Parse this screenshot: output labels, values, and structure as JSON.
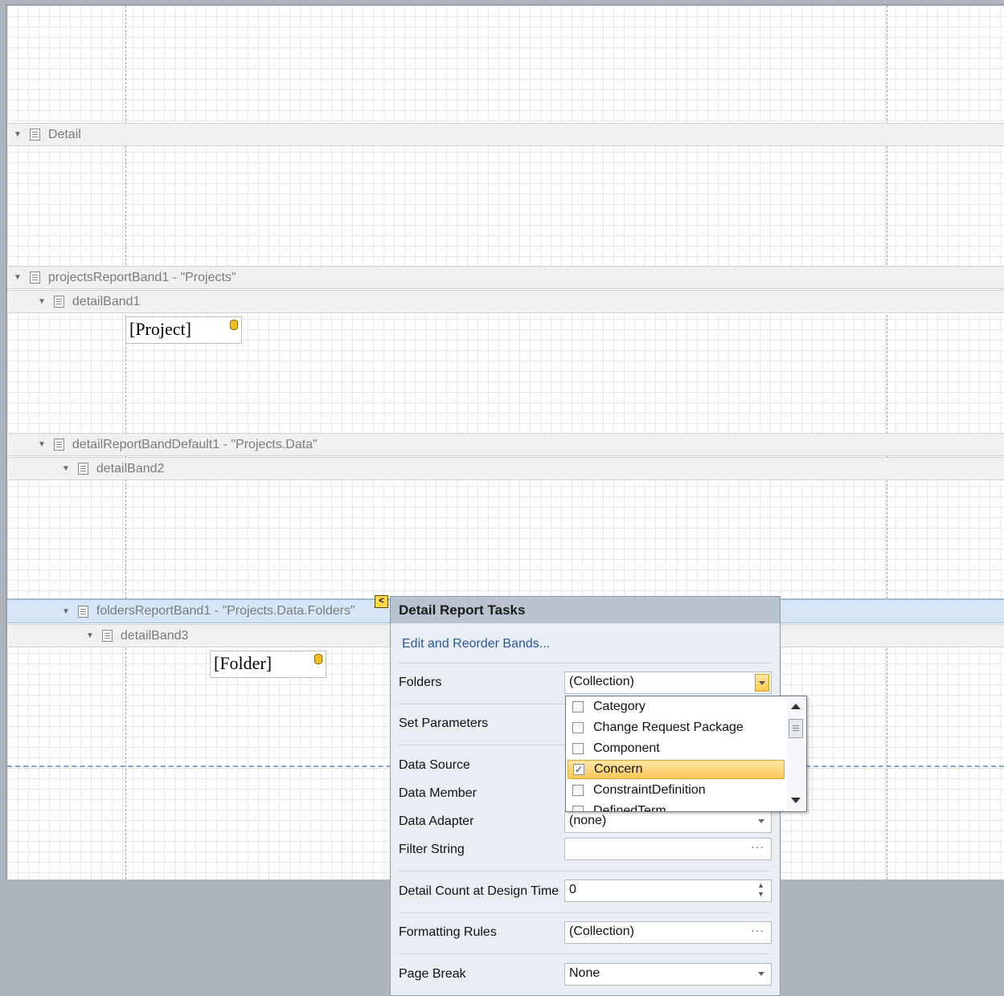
{
  "bands": [
    {
      "label": "Detail"
    },
    {
      "label": "projectsReportBand1 - \"Projects\""
    },
    {
      "label": "detailBand1"
    },
    {
      "label": "detailReportBandDefault1 - \"Projects.Data\""
    },
    {
      "label": "detailBand2"
    },
    {
      "label": "foldersReportBand1 - \"Projects.Data.Folders\""
    },
    {
      "label": "detailBand3"
    }
  ],
  "fields": {
    "project": "[Project]",
    "folder": "[Folder]"
  },
  "smart_tag": {
    "glyph": "<"
  },
  "tasks": {
    "title": "Detail Report Tasks",
    "link": "Edit and Reorder Bands...",
    "folders": {
      "label": "Folders",
      "value": "(Collection)"
    },
    "set_parameters": {
      "label": "Set Parameters"
    },
    "data_source": {
      "label": "Data Source"
    },
    "data_member": {
      "label": "Data Member"
    },
    "data_adapter": {
      "label": "Data Adapter",
      "value": "(none)"
    },
    "filter_string": {
      "label": "Filter String",
      "value": ""
    },
    "detail_count": {
      "label": "Detail Count at Design Time",
      "value": "0"
    },
    "formatting_rules": {
      "label": "Formatting Rules",
      "value": "(Collection)"
    },
    "page_break": {
      "label": "Page Break",
      "value": "None"
    }
  },
  "dropdown": {
    "items": [
      {
        "label": "Category",
        "checked": false
      },
      {
        "label": "Change Request Package",
        "checked": false
      },
      {
        "label": "Component",
        "checked": false
      },
      {
        "label": "Concern",
        "checked": true
      },
      {
        "label": "ConstraintDefinition",
        "checked": false
      },
      {
        "label": "DefinedTerm",
        "checked": false
      }
    ]
  },
  "colors": {
    "highlight": "#fcc95a",
    "link": "#2a56a0",
    "canvas_bg": "#aeb4be"
  }
}
